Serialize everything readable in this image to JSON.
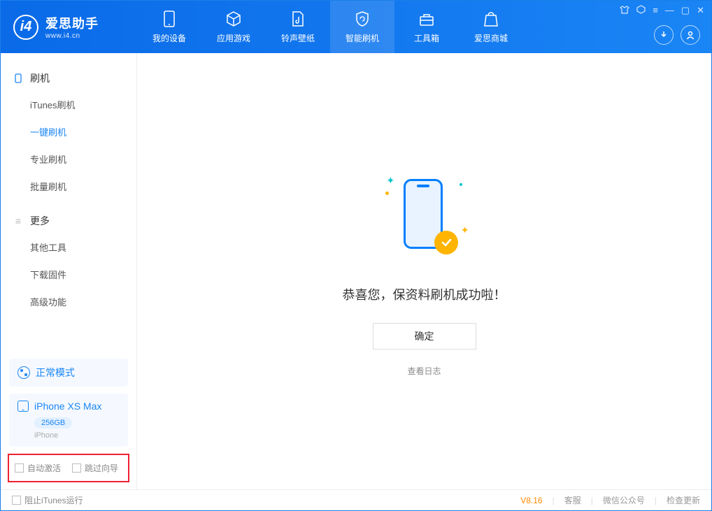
{
  "app": {
    "title": "爱思助手",
    "subtitle": "www.i4.cn"
  },
  "tabs": [
    {
      "label": "我的设备"
    },
    {
      "label": "应用游戏"
    },
    {
      "label": "铃声壁纸"
    },
    {
      "label": "智能刷机"
    },
    {
      "label": "工具箱"
    },
    {
      "label": "爱思商城"
    }
  ],
  "sidebar": {
    "group1_title": "刷机",
    "items1": [
      {
        "label": "iTunes刷机"
      },
      {
        "label": "一键刷机"
      },
      {
        "label": "专业刷机"
      },
      {
        "label": "批量刷机"
      }
    ],
    "group2_title": "更多",
    "items2": [
      {
        "label": "其他工具"
      },
      {
        "label": "下载固件"
      },
      {
        "label": "高级功能"
      }
    ]
  },
  "mode": {
    "label": "正常模式"
  },
  "device": {
    "name": "iPhone XS Max",
    "capacity": "256GB",
    "type": "iPhone"
  },
  "options": {
    "auto_activate": "自动激活",
    "skip_guide": "跳过向导"
  },
  "main": {
    "message": "恭喜您，保资料刷机成功啦！",
    "ok_label": "确定",
    "log_link": "查看日志"
  },
  "footer": {
    "block_itunes": "阻止iTunes运行",
    "version": "V8.16",
    "links": [
      "客服",
      "微信公众号",
      "检查更新"
    ]
  }
}
